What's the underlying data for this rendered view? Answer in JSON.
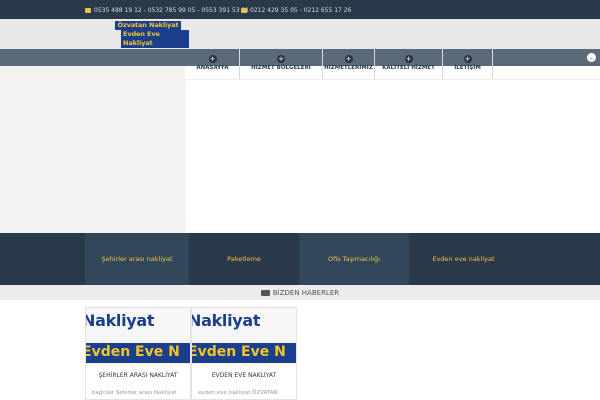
{
  "topbar": {
    "phones_mobile": "0535 488 19 12 - 0532 785 99 05 - 0553 391 53 91",
    "phones_landline": "0212 429 35 05 - 0212 655 17 26",
    "phone_icon": "phone-icon",
    "fax_icon": "fax-icon"
  },
  "logo": {
    "line1": "Özvatan Nakliyat",
    "line2": "Evden Eve Nakliyat"
  },
  "nav": {
    "items": [
      {
        "label": "ANASAYFA"
      },
      {
        "label": "HİZMET BÖLGELERİ"
      },
      {
        "label": "HİZMETLERİMİZ"
      },
      {
        "label": "KALİTELİ HİZMET"
      },
      {
        "label": "İLETİŞİM"
      }
    ]
  },
  "categories": [
    {
      "label": "Şehirler arası nakliyat"
    },
    {
      "label": "Paketleme"
    },
    {
      "label": "Ofis Taşımacılığı"
    },
    {
      "label": "Evden eve nakliyat"
    }
  ],
  "news": {
    "title": "BİZDEN HABERLER",
    "cards": [
      {
        "image_text_top": "Nakliyat",
        "image_text_bottom": "Evden Eve N",
        "title": "ŞEHİRLER ARASI NAKLİYAT",
        "excerpt": "bağcılar Şehirler arası Nakliyat"
      },
      {
        "image_text_top": "Nakliyat",
        "image_text_bottom": "Evden Eve N",
        "title": "EVDEN EVE NAKLİYAT",
        "excerpt": "evden eve nakliyat ÖZVATAN"
      }
    ]
  },
  "colors": {
    "dark": "#2b3a4a",
    "nav": "#5a6a78",
    "accent": "#f1c04c",
    "brand_blue": "#1b3e8e"
  }
}
